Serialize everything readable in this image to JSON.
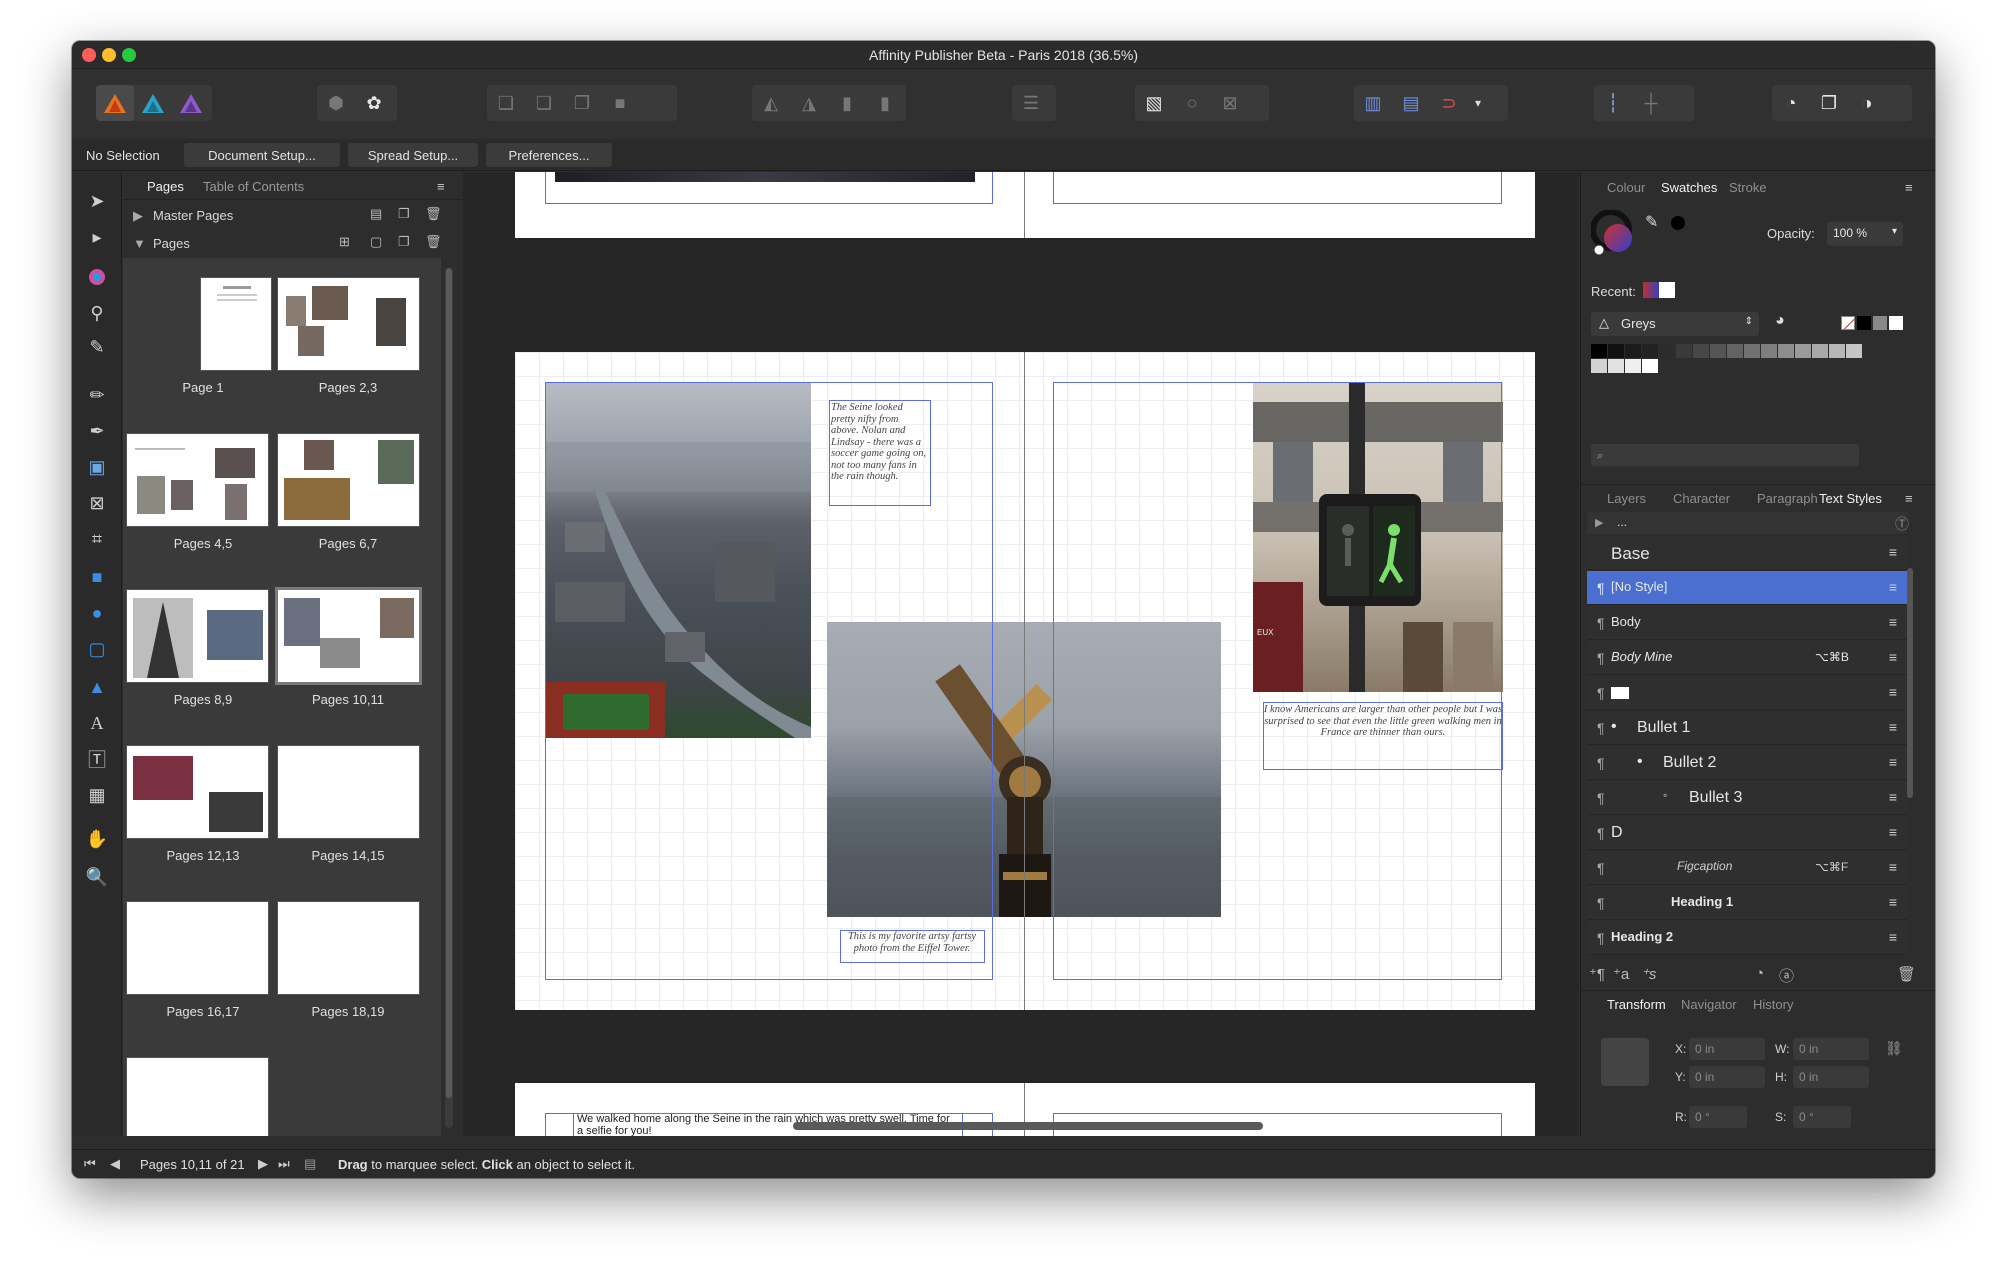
{
  "window": {
    "title": "Affinity Publisher Beta - Paris 2018 (36.5%)"
  },
  "context_bar": {
    "selection_label": "No Selection",
    "buttons": [
      "Document Setup...",
      "Spread Setup...",
      "Preferences..."
    ]
  },
  "left_panel": {
    "tabs": [
      "Pages",
      "Table of Contents"
    ],
    "master_pages_label": "Master Pages",
    "pages_label": "Pages",
    "thumbnails": [
      "Page 1",
      "Pages 2,3",
      "Pages 4,5",
      "Pages 6,7",
      "Pages 8,9",
      "Pages 10,11",
      "Pages 12,13",
      "Pages 14,15",
      "Pages 16,17",
      "Pages 18,19"
    ]
  },
  "canvas": {
    "caption_seine": "The Seine looked pretty nifty from above.  Nolan and Lindsay - there was a soccer game going on, not too many fans in the rain though.",
    "caption_americans": "I know Americans are larger than other people but I was surprised to see that even the little green walking men in France are thinner than ours.",
    "caption_telescope": "This is my favorite artsy fartsy photo from the Eiffel Tower.",
    "caption_walk": "We walked home along the Seine in the rain which was pretty swell. Time for a selfie for you!",
    "sign_text": "EUX"
  },
  "right_panel": {
    "color_tabs": [
      "Colour",
      "Swatches",
      "Stroke"
    ],
    "opacity_label": "Opacity:",
    "opacity_value": "100 %",
    "recent_label": "Recent:",
    "palette_name": "Greys",
    "styles_tabs": [
      "Layers",
      "Character",
      "Paragraph",
      "Text Styles"
    ],
    "styles_path": "...",
    "group_label": "Base",
    "styles": [
      {
        "name": "[No Style]",
        "shortcut": "",
        "selected": true
      },
      {
        "name": "Body",
        "shortcut": ""
      },
      {
        "name": "Body Mine",
        "shortcut": "⌥⌘B"
      },
      {
        "name": "",
        "shortcut": ""
      },
      {
        "name": "Bullet 1",
        "shortcut": ""
      },
      {
        "name": "Bullet 2",
        "shortcut": ""
      },
      {
        "name": "Bullet 3",
        "shortcut": ""
      },
      {
        "name": "D",
        "shortcut": ""
      },
      {
        "name": "Figcaption",
        "shortcut": "⌥⌘F"
      },
      {
        "name": "Heading 1",
        "shortcut": ""
      },
      {
        "name": "Heading 2",
        "shortcut": ""
      }
    ],
    "transform_tabs": [
      "Transform",
      "Navigator",
      "History"
    ],
    "transform": {
      "x_label": "X:",
      "x_value": "0 in",
      "y_label": "Y:",
      "y_value": "0 in",
      "w_label": "W:",
      "w_value": "0 in",
      "h_label": "H:",
      "h_value": "0 in",
      "r_label": "R:",
      "r_value": "0 °",
      "s_label": "S:",
      "s_value": "0 °"
    }
  },
  "status_bar": {
    "page_indicator": "Pages 10,11 of 21",
    "hint_drag": "Drag",
    "hint_drag_rest": " to marquee select. ",
    "hint_click": "Click",
    "hint_click_rest": " an object to select it."
  },
  "colors": {
    "accent": "#5b6fe0",
    "selection": "#4a6fd0",
    "panel": "#2d2d2d"
  }
}
